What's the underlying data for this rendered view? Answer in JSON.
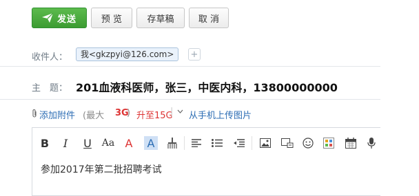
{
  "toolbar": {
    "send_label": "发送",
    "preview_label": "预 览",
    "save_draft_label": "存草稿",
    "cancel_label": "取 消"
  },
  "recipients": {
    "label": "收件人：",
    "chip": "我<gkzpyi@126.com>",
    "add_symbol": "+"
  },
  "subject": {
    "label": "主　题：",
    "value": "201血液科医师，张三，中医内科，13800000000"
  },
  "attachments": {
    "add_label": "添加附件",
    "limit_prefix": "(最大",
    "limit_value": "3G",
    "limit_suffix": ")",
    "upgrade_label": "升至15G",
    "separator": "|",
    "mobile_upload_label": "从手机上传图片"
  },
  "editor": {
    "buttons": [
      {
        "icon": "bold-icon",
        "glyph": "B"
      },
      {
        "icon": "italic-icon",
        "glyph": "I"
      },
      {
        "icon": "underline-icon",
        "glyph": "U"
      },
      {
        "icon": "font-size-icon",
        "glyph": "Aa"
      },
      {
        "icon": "font-color-icon",
        "glyph": "A"
      },
      {
        "icon": "highlight-icon",
        "glyph": "A"
      },
      {
        "icon": "format-painter-icon"
      },
      {
        "icon": "align-icon"
      },
      {
        "icon": "list-icon"
      },
      {
        "icon": "indent-icon"
      },
      {
        "icon": "image-icon"
      },
      {
        "icon": "screenshot-icon"
      },
      {
        "icon": "emoji-icon"
      },
      {
        "icon": "template-icon"
      },
      {
        "icon": "calendar-icon"
      },
      {
        "icon": "microphone-icon"
      }
    ],
    "body_text": "参加2017年第二批招聘考试"
  },
  "colors": {
    "send_green": "#3c9c32",
    "link_blue": "#2c6db4",
    "highlight_red": "#d33",
    "label_gray": "#6f7b86"
  }
}
